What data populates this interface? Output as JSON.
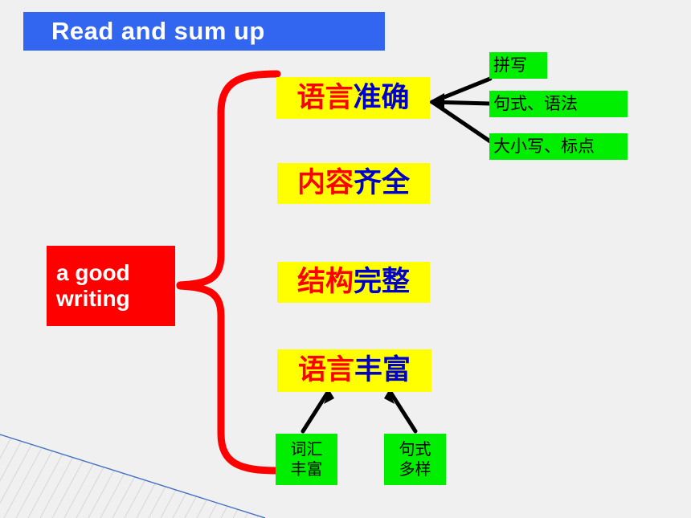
{
  "slide": {
    "background_color": "#f0f0f0",
    "title": {
      "text": "Read and sum up",
      "background_color": "#3366f0",
      "text_color": "#ffffff"
    },
    "root": {
      "line1": "a good",
      "line2": "writing",
      "background_color": "#ff0000",
      "text_color": "#ffffff"
    },
    "branches": [
      {
        "part_a": "语言",
        "part_b": "准确",
        "background_color": "#ffff00",
        "color_a": "#ff0000",
        "color_b": "#0000cc"
      },
      {
        "part_a": "内容",
        "part_b": "齐全",
        "background_color": "#ffff00",
        "color_a": "#ff0000",
        "color_b": "#0000cc"
      },
      {
        "part_a": "结构",
        "part_b": "完整",
        "background_color": "#ffff00",
        "color_a": "#ff0000",
        "color_b": "#0000cc"
      },
      {
        "part_a": "语言",
        "part_b": "丰富",
        "background_color": "#ffff00",
        "color_a": "#ff0000",
        "color_b": "#0000cc"
      }
    ],
    "accuracy_details": [
      {
        "text": "拼写",
        "background_color": "#00ee00"
      },
      {
        "text": "句式、语法",
        "background_color": "#00ee00"
      },
      {
        "text": "大小写、标点",
        "background_color": "#00ee00"
      }
    ],
    "richness_details": [
      {
        "line1": "词汇",
        "line2": "丰富",
        "background_color": "#00ee00"
      },
      {
        "line1": "句式",
        "line2": "多样",
        "background_color": "#00ee00"
      }
    ],
    "decoration": {
      "hatch_line_color": "#d8d8d8",
      "edge_line_color": "#4472c4"
    },
    "connector_colors": {
      "brace": "#ff0000",
      "arrow": "#000000"
    }
  }
}
